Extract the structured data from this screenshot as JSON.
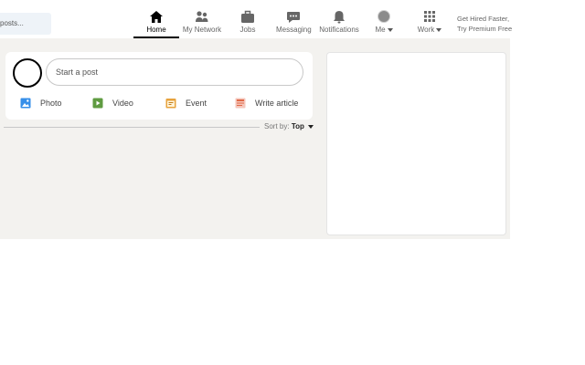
{
  "search": {
    "placeholder": "posts..."
  },
  "nav": {
    "items": [
      {
        "label": "Home",
        "icon": "home-icon",
        "active": true
      },
      {
        "label": "My Network",
        "icon": "network-icon"
      },
      {
        "label": "Jobs",
        "icon": "briefcase-icon"
      },
      {
        "label": "Messaging",
        "icon": "message-icon"
      },
      {
        "label": "Notifications",
        "icon": "bell-icon"
      },
      {
        "label": "Me",
        "icon": "avatar"
      },
      {
        "label": "Work",
        "icon": "grid-icon"
      }
    ],
    "premium_line1": "Get Hired Faster,",
    "premium_line2": "Try Premium Free"
  },
  "share": {
    "start_post": "Start a post",
    "actions": [
      {
        "label": "Photo",
        "icon": "photo-icon",
        "color": "#378fe9"
      },
      {
        "label": "Video",
        "icon": "video-icon",
        "color": "#5f9b41"
      },
      {
        "label": "Event",
        "icon": "event-icon",
        "color": "#c37d16"
      },
      {
        "label": "Write article",
        "icon": "article-icon",
        "color": "#e06847"
      }
    ]
  },
  "feed": {
    "sort_label": "Sort by:",
    "sort_value": "Top"
  }
}
